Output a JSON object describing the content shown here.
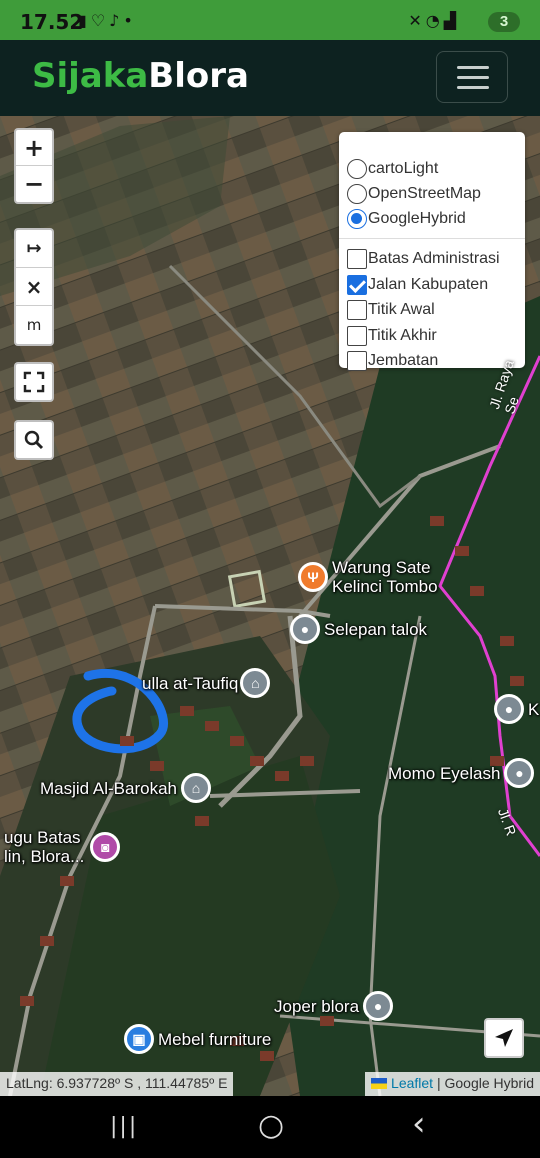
{
  "status_bar": {
    "time": "17.52",
    "left_icons": [
      "battery-saver-icon",
      "heart-icon",
      "tiktok-icon",
      "dot-icon"
    ],
    "right_icons": [
      "mute-icon",
      "wifi-icon",
      "signal-icon"
    ],
    "battery": "3"
  },
  "navbar": {
    "brand_part1": "Sijaka",
    "brand_part2": "Blora",
    "brand_color": "#3dbb45",
    "menu_icon": "hamburger-icon"
  },
  "map_controls": {
    "zoom_in": "+",
    "zoom_out": "−",
    "measure": "↦",
    "clear": "×",
    "unit": "m",
    "fullscreen_icon": "fullscreen-icon",
    "search_icon": "search-icon",
    "locate_icon": "locate-arrow-icon"
  },
  "layers": {
    "base": [
      {
        "label": "cartoLight",
        "selected": false
      },
      {
        "label": "OpenStreetMap",
        "selected": false
      },
      {
        "label": "GoogleHybrid",
        "selected": true
      }
    ],
    "overlays": [
      {
        "label": "Batas Administrasi",
        "checked": false
      },
      {
        "label": "Jalan Kabupaten",
        "checked": true
      },
      {
        "label": "Titik Awal",
        "checked": false
      },
      {
        "label": "Titik Akhir",
        "checked": false
      },
      {
        "label": "Jembatan",
        "checked": false
      }
    ]
  },
  "pois": [
    {
      "label": "Warung Sate Kelinci Tombo",
      "line1": "Warung Sate",
      "line2": "Kelinci Tombo",
      "color": "#f07b2c",
      "icon": "restaurant-icon"
    },
    {
      "label": "Selepan talok",
      "color": "#7d8a93",
      "icon": "pin-icon"
    },
    {
      "label": "ulla at-Taufiq",
      "color": "#7d8a93",
      "icon": "mosque-icon"
    },
    {
      "label": "Masjid Al-Barokah",
      "color": "#7d8a93",
      "icon": "mosque-icon"
    },
    {
      "label": "Momo Eyelash",
      "color": "#7d8a93",
      "icon": "pin-icon"
    },
    {
      "label": "K",
      "color": "#7d8a93",
      "icon": "pin-icon"
    },
    {
      "label": "ugu Batas lin, Blora...",
      "line1": "ugu Batas",
      "line2": "lin, Blora...",
      "color": "#b04aa8",
      "icon": "camera-icon"
    },
    {
      "label": "Joper blora",
      "color": "#7d8a93",
      "icon": "pin-icon"
    },
    {
      "label": "Mebel furniture",
      "color": "#2a7ee0",
      "icon": "shop-icon"
    }
  ],
  "road_label": "Jl. Raya Se",
  "road_label_2": "Jl. R",
  "footer": {
    "coords": "LatLng: 6.937728º S , 111.44785º E",
    "leaflet": "Leaflet",
    "separator": " | ",
    "provider": "Google Hybrid"
  },
  "system_nav": {
    "recent": "|||",
    "home": "○",
    "back": "‹"
  }
}
